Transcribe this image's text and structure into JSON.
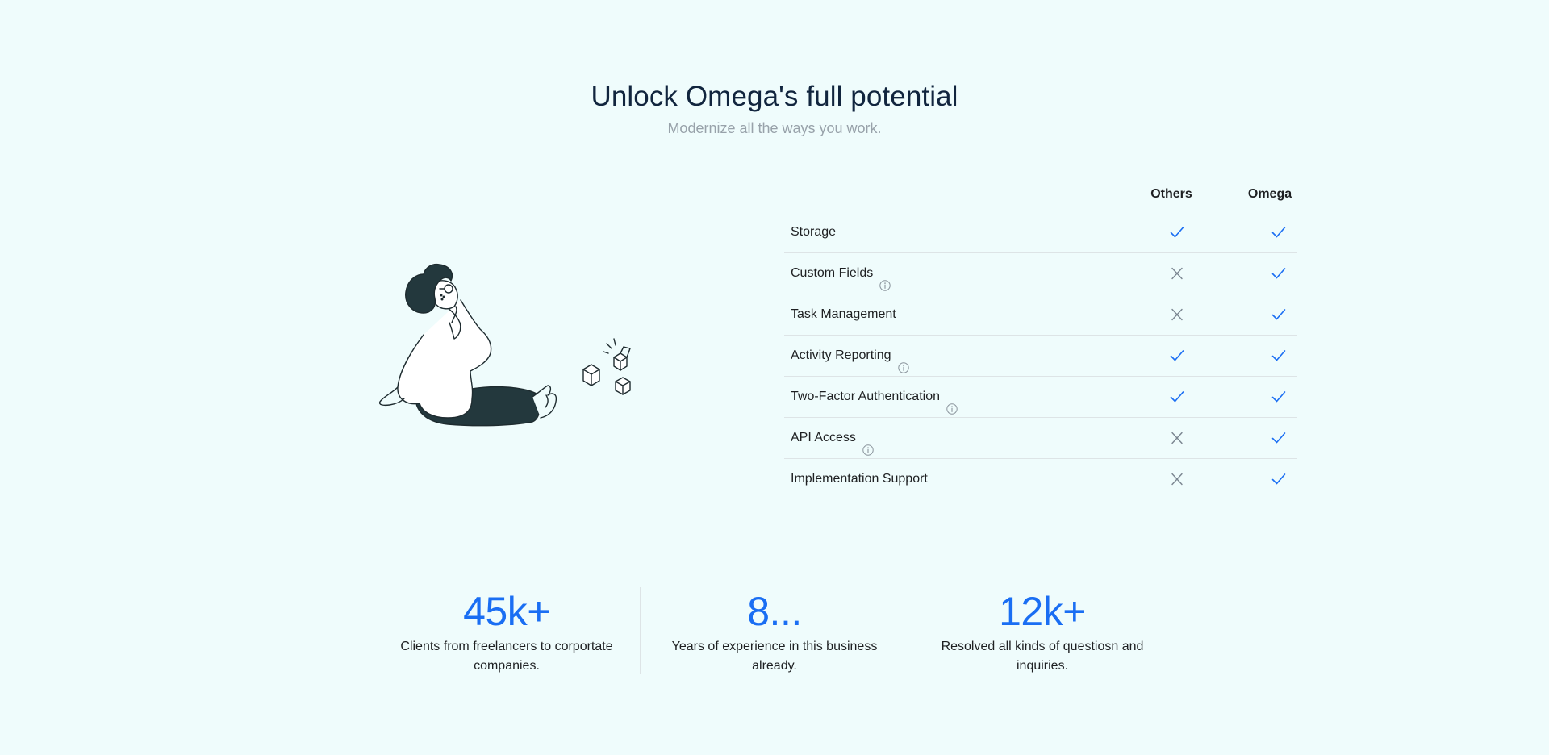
{
  "hero": {
    "title": "Unlock Omega's full potential",
    "subtitle": "Modernize all the ways you work."
  },
  "comparison": {
    "columns": [
      "Others",
      "Omega"
    ],
    "rows": [
      {
        "feature": "Storage",
        "info": false,
        "others": "check",
        "omega": "check"
      },
      {
        "feature": "Custom Fields",
        "info": true,
        "others": "cross",
        "omega": "check"
      },
      {
        "feature": "Task Management",
        "info": false,
        "others": "cross",
        "omega": "check"
      },
      {
        "feature": "Activity Reporting",
        "info": true,
        "others": "check",
        "omega": "check"
      },
      {
        "feature": "Two-Factor Authentication",
        "info": true,
        "others": "check",
        "omega": "check"
      },
      {
        "feature": "API Access",
        "info": true,
        "others": "cross",
        "omega": "check"
      },
      {
        "feature": "Implementation Support",
        "info": false,
        "others": "cross",
        "omega": "check"
      }
    ]
  },
  "stats": [
    {
      "value": "45k+",
      "description": "Clients from freelancers to corportate companies."
    },
    {
      "value": "8...",
      "description": "Years of experience in this business already."
    },
    {
      "value": "12k+",
      "description": "Resolved all kinds of questiosn and inquiries."
    }
  ],
  "colors": {
    "accent": "#1a6ef3",
    "background": "#effcfc",
    "heading": "#11253e",
    "muted": "#98a2aa",
    "cross": "#7a8590",
    "divider": "#dde4e6"
  },
  "icons": {
    "check": "check-icon",
    "cross": "cross-icon",
    "info": "info-icon"
  }
}
